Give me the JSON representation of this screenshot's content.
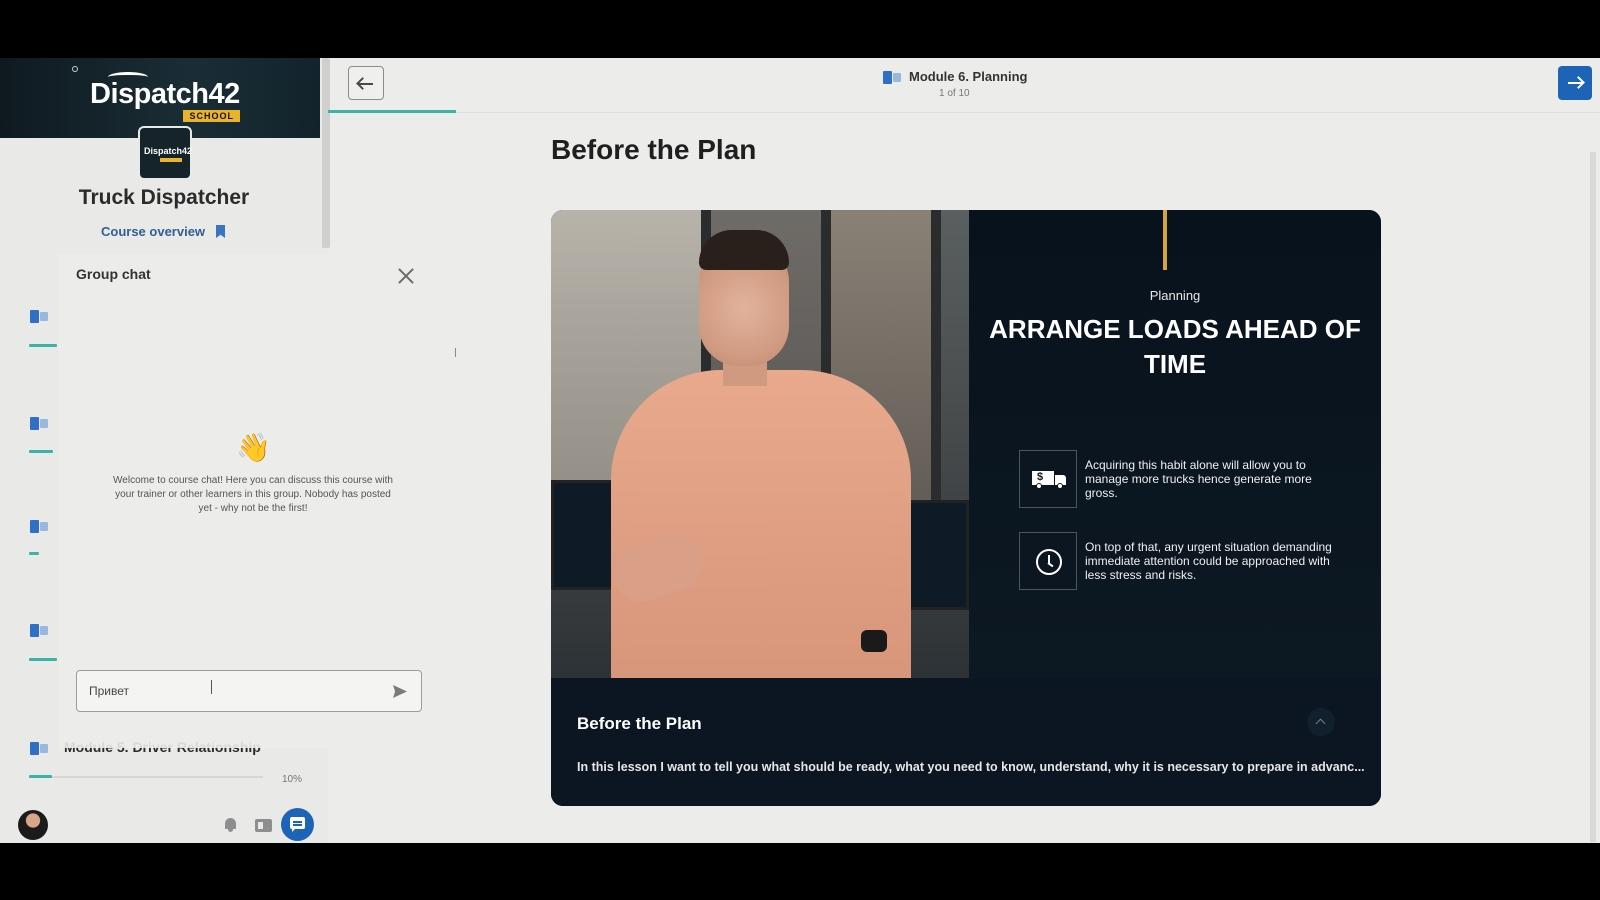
{
  "brand": {
    "logo_text": "Dispatch42",
    "logo_tag": "SCHOOL"
  },
  "course": {
    "title": "Truck Dispatcher",
    "overview_label": "Course overview"
  },
  "sidebar": {
    "modules": [
      {
        "label": "",
        "progress": 1.0
      },
      {
        "label": "",
        "progress": 1.0
      },
      {
        "label": "",
        "progress": 0.4
      },
      {
        "label": "",
        "progress": 1.0
      },
      {
        "label": "Module 5. Driver Relationship",
        "progress": 0.1,
        "progress_label": "10%"
      }
    ]
  },
  "chat": {
    "title": "Group chat",
    "welcome": "Welcome to course chat! Here you can discuss this course with your trainer or other learners in this group. Nobody has posted yet - why not be the first!",
    "input_value": "Привет"
  },
  "header": {
    "module_title": "Module 6. Planning",
    "module_position": "1 of 10"
  },
  "lesson": {
    "title": "Before the Plan",
    "slide_kicker": "Planning",
    "slide_title": "ARRANGE LOADS AHEAD OF TIME",
    "feature_1": "Acquiring this habit alone will allow you to manage more trucks hence generate more gross.",
    "feature_2": "On top of that, any urgent situation demanding immediate attention could be approached with less stress and risks.",
    "caption_title": "Before the Plan",
    "caption_text": "In this lesson I want to tell you what should be ready, what you need to know, understand, why it is necessary to prepare in advanc..."
  },
  "colors": {
    "accent": "#1d64b7",
    "progress": "#3bb3a6",
    "gold": "#d2a63a"
  }
}
